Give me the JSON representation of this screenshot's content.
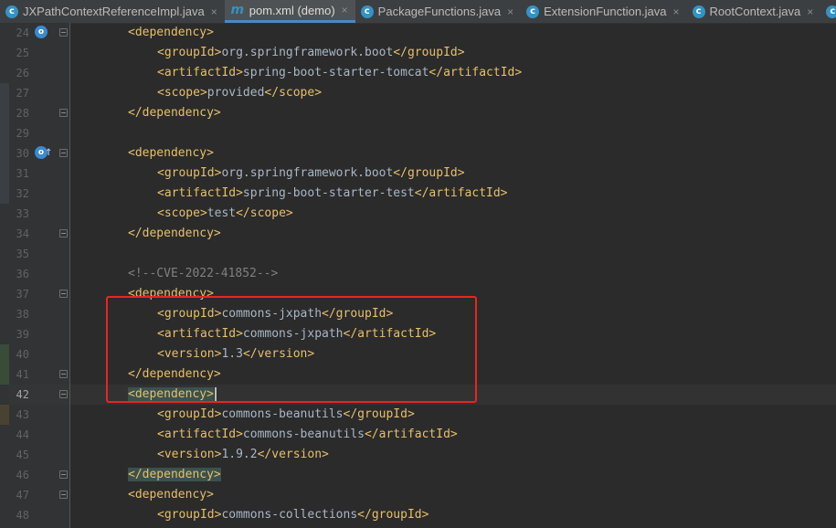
{
  "tabs": [
    {
      "label": "JXPathContextReferenceImpl.java",
      "icon": "class-icon",
      "icon_char": "c",
      "active": false
    },
    {
      "label": "pom.xml (demo)",
      "icon": "maven-icon",
      "icon_char": "m",
      "active": true
    },
    {
      "label": "PackageFunctions.java",
      "icon": "class-icon",
      "icon_char": "c",
      "active": false
    },
    {
      "label": "ExtensionFunction.java",
      "icon": "interface-icon",
      "icon_char": "c",
      "active": false
    },
    {
      "label": "RootContext.java",
      "icon": "class-icon",
      "icon_char": "c",
      "active": false
    },
    {
      "label": "",
      "icon": "class-icon",
      "icon_char": "c",
      "active": false
    }
  ],
  "tab_close_glyph": "×",
  "current_line": 42,
  "colors": {
    "tag": "#e8bf6a",
    "text": "#a9b7c6",
    "comment": "#808080",
    "background": "#2b2b2b",
    "annotation_box": "#e8261f",
    "brace_match": "#3b514d"
  },
  "lines": [
    {
      "num": "24",
      "indent": 1,
      "parts": [
        {
          "t": "<dependency>",
          "c": "tag"
        }
      ],
      "fold": true,
      "gutter_icon": "override-icon"
    },
    {
      "num": "25",
      "indent": 2,
      "parts": [
        {
          "t": "<groupId>",
          "c": "tag"
        },
        {
          "t": "org.springframework.boot",
          "c": "txt"
        },
        {
          "t": "</groupId>",
          "c": "tag"
        }
      ]
    },
    {
      "num": "26",
      "indent": 2,
      "parts": [
        {
          "t": "<artifactId>",
          "c": "tag"
        },
        {
          "t": "spring-boot-starter-tomcat",
          "c": "txt"
        },
        {
          "t": "</artifactId>",
          "c": "tag"
        }
      ]
    },
    {
      "num": "27",
      "indent": 2,
      "parts": [
        {
          "t": "<scope>",
          "c": "tag"
        },
        {
          "t": "provided",
          "c": "txt"
        },
        {
          "t": "</scope>",
          "c": "tag"
        }
      ]
    },
    {
      "num": "28",
      "indent": 1,
      "parts": [
        {
          "t": "</dependency>",
          "c": "tag"
        }
      ],
      "fold": true
    },
    {
      "num": "29",
      "indent": 0,
      "parts": []
    },
    {
      "num": "30",
      "indent": 1,
      "parts": [
        {
          "t": "<dependency>",
          "c": "tag"
        }
      ],
      "fold": true,
      "gutter_icon": "override-up-icon"
    },
    {
      "num": "31",
      "indent": 2,
      "parts": [
        {
          "t": "<groupId>",
          "c": "tag"
        },
        {
          "t": "org.springframework.boot",
          "c": "txt"
        },
        {
          "t": "</groupId>",
          "c": "tag"
        }
      ]
    },
    {
      "num": "32",
      "indent": 2,
      "parts": [
        {
          "t": "<artifactId>",
          "c": "tag"
        },
        {
          "t": "spring-boot-starter-test",
          "c": "txt"
        },
        {
          "t": "</artifactId>",
          "c": "tag"
        }
      ]
    },
    {
      "num": "33",
      "indent": 2,
      "parts": [
        {
          "t": "<scope>",
          "c": "tag"
        },
        {
          "t": "test",
          "c": "txt"
        },
        {
          "t": "</scope>",
          "c": "tag"
        }
      ]
    },
    {
      "num": "34",
      "indent": 1,
      "parts": [
        {
          "t": "</dependency>",
          "c": "tag"
        }
      ],
      "fold": true
    },
    {
      "num": "35",
      "indent": 0,
      "parts": []
    },
    {
      "num": "36",
      "indent": 1,
      "parts": [
        {
          "t": "<!--CVE-2022-41852-->",
          "c": "cmt"
        }
      ]
    },
    {
      "num": "37",
      "indent": 1,
      "parts": [
        {
          "t": "<dependency>",
          "c": "tag"
        }
      ],
      "fold": true
    },
    {
      "num": "38",
      "indent": 2,
      "parts": [
        {
          "t": "<groupId>",
          "c": "tag"
        },
        {
          "t": "commons-jxpath",
          "c": "txt"
        },
        {
          "t": "</groupId>",
          "c": "tag"
        }
      ]
    },
    {
      "num": "39",
      "indent": 2,
      "parts": [
        {
          "t": "<artifactId>",
          "c": "tag"
        },
        {
          "t": "commons-jxpath",
          "c": "txt"
        },
        {
          "t": "</artifactId>",
          "c": "tag"
        }
      ]
    },
    {
      "num": "40",
      "indent": 2,
      "parts": [
        {
          "t": "<version>",
          "c": "tag"
        },
        {
          "t": "1.3",
          "c": "txt"
        },
        {
          "t": "</version>",
          "c": "tag"
        }
      ]
    },
    {
      "num": "41",
      "indent": 1,
      "parts": [
        {
          "t": "</dependency>",
          "c": "tag"
        }
      ],
      "fold": true
    },
    {
      "num": "42",
      "indent": 1,
      "parts": [
        {
          "t": "<dependency>",
          "c": "tag",
          "hl": true
        }
      ],
      "fold": true,
      "caret": true
    },
    {
      "num": "43",
      "indent": 2,
      "parts": [
        {
          "t": "<groupId>",
          "c": "tag"
        },
        {
          "t": "commons-beanutils",
          "c": "txt"
        },
        {
          "t": "</groupId>",
          "c": "tag"
        }
      ]
    },
    {
      "num": "44",
      "indent": 2,
      "parts": [
        {
          "t": "<artifactId>",
          "c": "tag"
        },
        {
          "t": "commons-beanutils",
          "c": "txt"
        },
        {
          "t": "</artifactId>",
          "c": "tag"
        }
      ]
    },
    {
      "num": "45",
      "indent": 2,
      "parts": [
        {
          "t": "<version>",
          "c": "tag"
        },
        {
          "t": "1.9.2",
          "c": "txt"
        },
        {
          "t": "</version>",
          "c": "tag"
        }
      ]
    },
    {
      "num": "46",
      "indent": 1,
      "parts": [
        {
          "t": "</dependency>",
          "c": "tag",
          "hl": true
        }
      ],
      "fold": true
    },
    {
      "num": "47",
      "indent": 1,
      "parts": [
        {
          "t": "<dependency>",
          "c": "tag"
        }
      ],
      "fold": true
    },
    {
      "num": "48",
      "indent": 2,
      "parts": [
        {
          "t": "<groupId>",
          "c": "tag"
        },
        {
          "t": "commons-collections",
          "c": "txt"
        },
        {
          "t": "</groupId>",
          "c": "tag"
        }
      ]
    }
  ]
}
